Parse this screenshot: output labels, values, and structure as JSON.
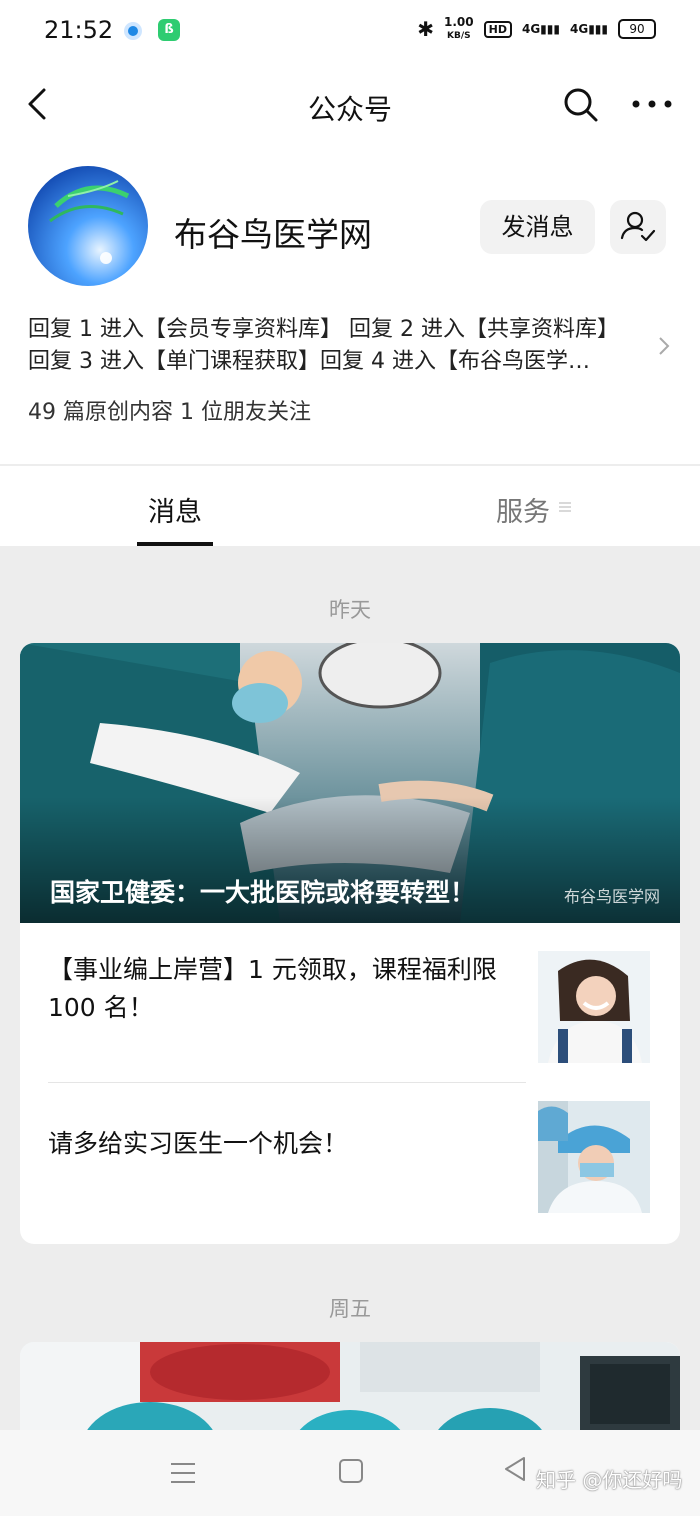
{
  "status_bar": {
    "time": "21:52",
    "speed_value": "1.00",
    "speed_unit": "KB/S",
    "hd": "HD",
    "signal1": "4G",
    "signal2": "4G",
    "battery": "90"
  },
  "nav": {
    "title": "公众号",
    "back_icon": "chevron-left-icon",
    "search_icon": "search-icon",
    "more_icon": "more-icon"
  },
  "profile": {
    "name": "布谷鸟医学网",
    "send_message": "发消息",
    "intro_line1": "回复 1 进入【会员专享资料库】 回复 2 进入【共享资料库】",
    "intro_line2": "回复 3 进入【单门课程获取】回复 4 进入【布谷鸟医学…",
    "stats": "49 篇原创内容  1 位朋友关注"
  },
  "tabs": {
    "messages": "消息",
    "service": "服务"
  },
  "feed": {
    "group1_date": "昨天",
    "cover_title": "国家卫健委：一大批医院或将要转型！",
    "cover_watermark": "布谷鸟医学网",
    "article1_title": "【事业编上岸营】1 元领取，课程福利限 100 名！",
    "article2_title": "请多给实习医生一个机会！",
    "group2_date": "周五"
  },
  "bottom": {
    "watermark": "知乎 @你还好吗"
  },
  "colors": {
    "accent": "#1e88e5",
    "background": "#ededed"
  }
}
